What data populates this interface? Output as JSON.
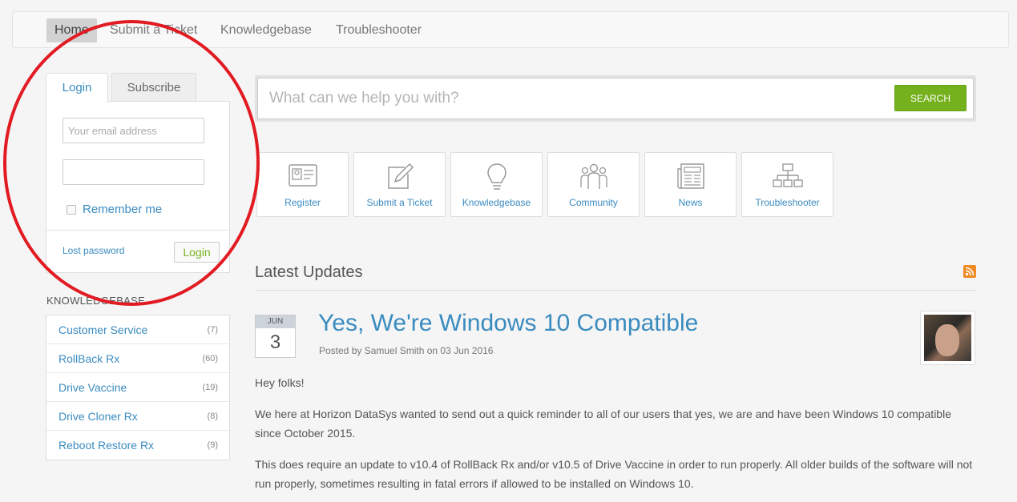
{
  "nav": {
    "items": [
      {
        "label": "Home",
        "active": true
      },
      {
        "label": "Submit a Ticket"
      },
      {
        "label": "Knowledgebase"
      },
      {
        "label": "Troubleshooter"
      }
    ]
  },
  "login": {
    "tabs": {
      "login": "Login",
      "subscribe": "Subscribe"
    },
    "email_placeholder": "Your email address",
    "password_value": "",
    "remember_label": "Remember me",
    "lost_password": "Lost password",
    "login_button": "Login"
  },
  "knowledgebase": {
    "title": "KNOWLEDGEBASE",
    "items": [
      {
        "name": "Customer Service",
        "count": "(7)"
      },
      {
        "name": "RollBack Rx",
        "count": "(60)"
      },
      {
        "name": "Drive Vaccine",
        "count": "(19)"
      },
      {
        "name": "Drive Cloner Rx",
        "count": "(8)"
      },
      {
        "name": "Reboot Restore Rx",
        "count": "(9)"
      }
    ]
  },
  "search": {
    "placeholder": "What can we help you with?",
    "button": "SEARCH"
  },
  "tiles": [
    {
      "label": "Register",
      "icon": "id-card-icon"
    },
    {
      "label": "Submit a Ticket",
      "icon": "edit-icon"
    },
    {
      "label": "Knowledgebase",
      "icon": "lightbulb-icon"
    },
    {
      "label": "Community",
      "icon": "people-icon"
    },
    {
      "label": "News",
      "icon": "newspaper-icon"
    },
    {
      "label": "Troubleshooter",
      "icon": "sitemap-icon"
    }
  ],
  "updates": {
    "title": "Latest Updates",
    "post": {
      "month": "JUN",
      "day": "3",
      "title": "Yes, We're Windows 10 Compatible",
      "meta": "Posted by Samuel Smith on 03 Jun 2016",
      "paragraphs": [
        "Hey folks!",
        "We here at Horizon DataSys wanted to send out a quick reminder to all of our users that yes, we are and have been Windows 10 compatible since October 2015.",
        "This does require an update to v10.4 of RollBack Rx and/or v10.5 of Drive Vaccine in order to run properly. All older builds of the software will not run properly, sometimes resulting in fatal errors if allowed to be installed on Windows 10."
      ]
    }
  },
  "colors": {
    "link": "#3a8bbf",
    "accent_green": "#75b11d",
    "annotation_red": "#e21b23",
    "rss_orange": "#f08a24"
  }
}
